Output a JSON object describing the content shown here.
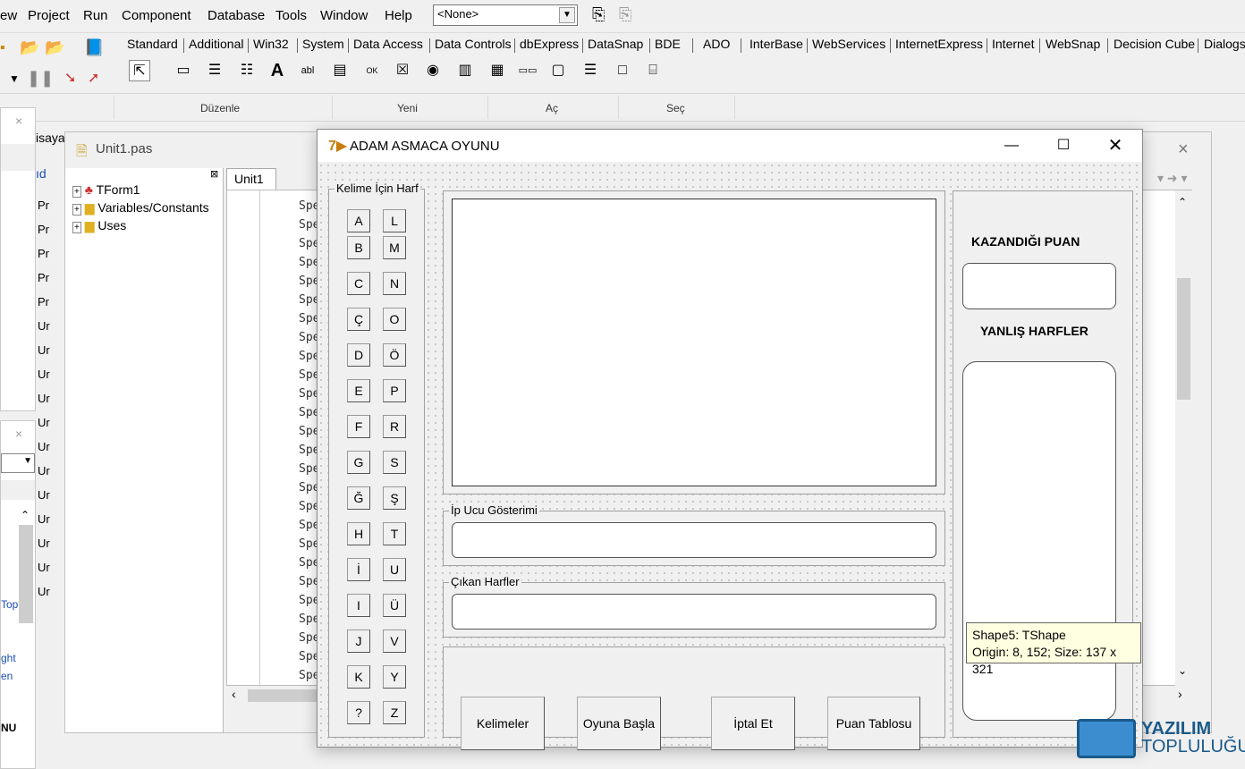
{
  "menubar": {
    "items": [
      "ew",
      "Project",
      "Run",
      "Component",
      "Database",
      "Tools",
      "Window",
      "Help"
    ],
    "combo_value": "<None>"
  },
  "palette": {
    "tabs": [
      "Standard",
      "Additional",
      "Win32",
      "System",
      "Data Access",
      "Data Controls",
      "dbExpress",
      "DataSnap",
      "BDE",
      "ADO",
      "InterBase",
      "WebServices",
      "InternetExpress",
      "Internet",
      "WebSnap",
      "Decision Cube",
      "Dialogs"
    ]
  },
  "ribbon": {
    "labels": [
      "Düzenle",
      "Yeni",
      "Aç",
      "Seç"
    ]
  },
  "left_panel": {
    "label_isaya": "isaya",
    "label_ad": "ıd",
    "label_top": "Top",
    "label_ght": "ght",
    "label_en": "en",
    "label_nu": "NU",
    "items": [
      "Pr",
      "Pr",
      "Pr",
      "Pr",
      "Pr",
      "Ur",
      "Ur",
      "Ur",
      "Ur",
      "Ur",
      "Ur",
      "Ur",
      "Ur",
      "Ur",
      "Ur",
      "Ur",
      "Ur"
    ]
  },
  "unit_window": {
    "title": "Unit1.pas",
    "tab": "Unit1",
    "tree": [
      "TForm1",
      "Variables/Constants",
      "Uses"
    ],
    "code_lines": [
      "Spe",
      "Spe",
      "Spe",
      "Spe",
      "Spe",
      "Spe",
      "Spe",
      "Spe",
      "Spe",
      "Spe",
      "Spe",
      "Spe",
      "Spe",
      "Spe",
      "Spe",
      "Spe",
      "Spe",
      "Spe",
      "Spe",
      "Spe",
      "Spe",
      "Spe",
      "Spe",
      "Spe",
      "Spe",
      "Spe"
    ]
  },
  "form": {
    "title": "ADAM ASMACA OYUNU",
    "letters_group": "Kelime İçin Harf",
    "letters_left": [
      "A",
      "B",
      "C",
      "Ç",
      "D",
      "E",
      "F",
      "G",
      "Ğ",
      "H",
      "İ",
      "I",
      "J",
      "K",
      "?"
    ],
    "letters_right": [
      "L",
      "M",
      "N",
      "O",
      "Ö",
      "P",
      "R",
      "S",
      "Ş",
      "T",
      "U",
      "Ü",
      "V",
      "Y",
      "Z"
    ],
    "hint_group": "İp Ucu Gösterimi",
    "found_group": "Çıkan Harfler",
    "buttons": [
      "Kelimeler",
      "Oyuna Başla",
      "İptal Et",
      "Puan Tablosu"
    ],
    "score_label": "KAZANDIĞI PUAN",
    "wrong_label": "YANLIŞ HARFLER"
  },
  "tooltip": {
    "line1": "Shape5: TShape",
    "line2": "Origin: 8, 152; Size: 137 x 321"
  },
  "watermark": {
    "line1": "YAZILIM",
    "line2": "TOPLULUĞU"
  }
}
